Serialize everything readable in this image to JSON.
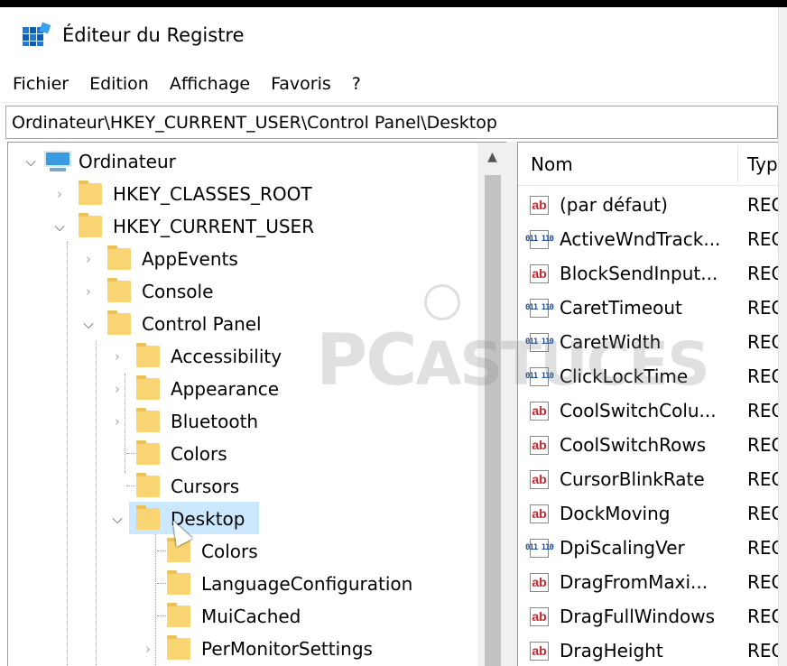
{
  "window": {
    "title": "Éditeur du Registre",
    "app_icon": "registry-editor-icon"
  },
  "menu": [
    {
      "label": "Fichier"
    },
    {
      "label": "Edition"
    },
    {
      "label": "Affichage"
    },
    {
      "label": "Favoris"
    },
    {
      "label": "?"
    }
  ],
  "address": {
    "path": "Ordinateur\\HKEY_CURRENT_USER\\Control Panel\\Desktop"
  },
  "tree": {
    "root": "Ordinateur",
    "hkcr": "HKEY_CLASSES_ROOT",
    "hkcu": "HKEY_CURRENT_USER",
    "appevents": "AppEvents",
    "console": "Console",
    "control_panel": "Control Panel",
    "accessibility": "Accessibility",
    "appearance": "Appearance",
    "bluetooth": "Bluetooth",
    "colors": "Colors",
    "cursors": "Cursors",
    "desktop": "Desktop",
    "desktop_colors": "Colors",
    "language_configuration": "LanguageConfiguration",
    "mui_cached": "MuiCached",
    "per_monitor_settings": "PerMonitorSettings"
  },
  "list": {
    "columns": {
      "name": "Nom",
      "type": "Type"
    },
    "rows": [
      {
        "icon": "ab",
        "name": "(par défaut)",
        "type": "REG_"
      },
      {
        "icon": "bin",
        "name": "ActiveWndTrack...",
        "type": "REG_"
      },
      {
        "icon": "ab",
        "name": "BlockSendInput...",
        "type": "REG_"
      },
      {
        "icon": "bin",
        "name": "CaretTimeout",
        "type": "REG_"
      },
      {
        "icon": "bin",
        "name": "CaretWidth",
        "type": "REG_"
      },
      {
        "icon": "bin",
        "name": "ClickLockTime",
        "type": "REG_"
      },
      {
        "icon": "ab",
        "name": "CoolSwitchColu...",
        "type": "REG_"
      },
      {
        "icon": "ab",
        "name": "CoolSwitchRows",
        "type": "REG_"
      },
      {
        "icon": "ab",
        "name": "CursorBlinkRate",
        "type": "REG_"
      },
      {
        "icon": "ab",
        "name": "DockMoving",
        "type": "REG_"
      },
      {
        "icon": "bin",
        "name": "DpiScalingVer",
        "type": "REG_"
      },
      {
        "icon": "ab",
        "name": "DragFromMaxi...",
        "type": "REG_"
      },
      {
        "icon": "ab",
        "name": "DragFullWindows",
        "type": "REG_"
      },
      {
        "icon": "ab",
        "name": "DragHeight",
        "type": "REG_"
      }
    ]
  },
  "watermark": {
    "text_pc": "PC",
    "text_astuces": "ASTUCES"
  },
  "icons": {
    "string_value": "ab",
    "binary_value": "011 110"
  }
}
